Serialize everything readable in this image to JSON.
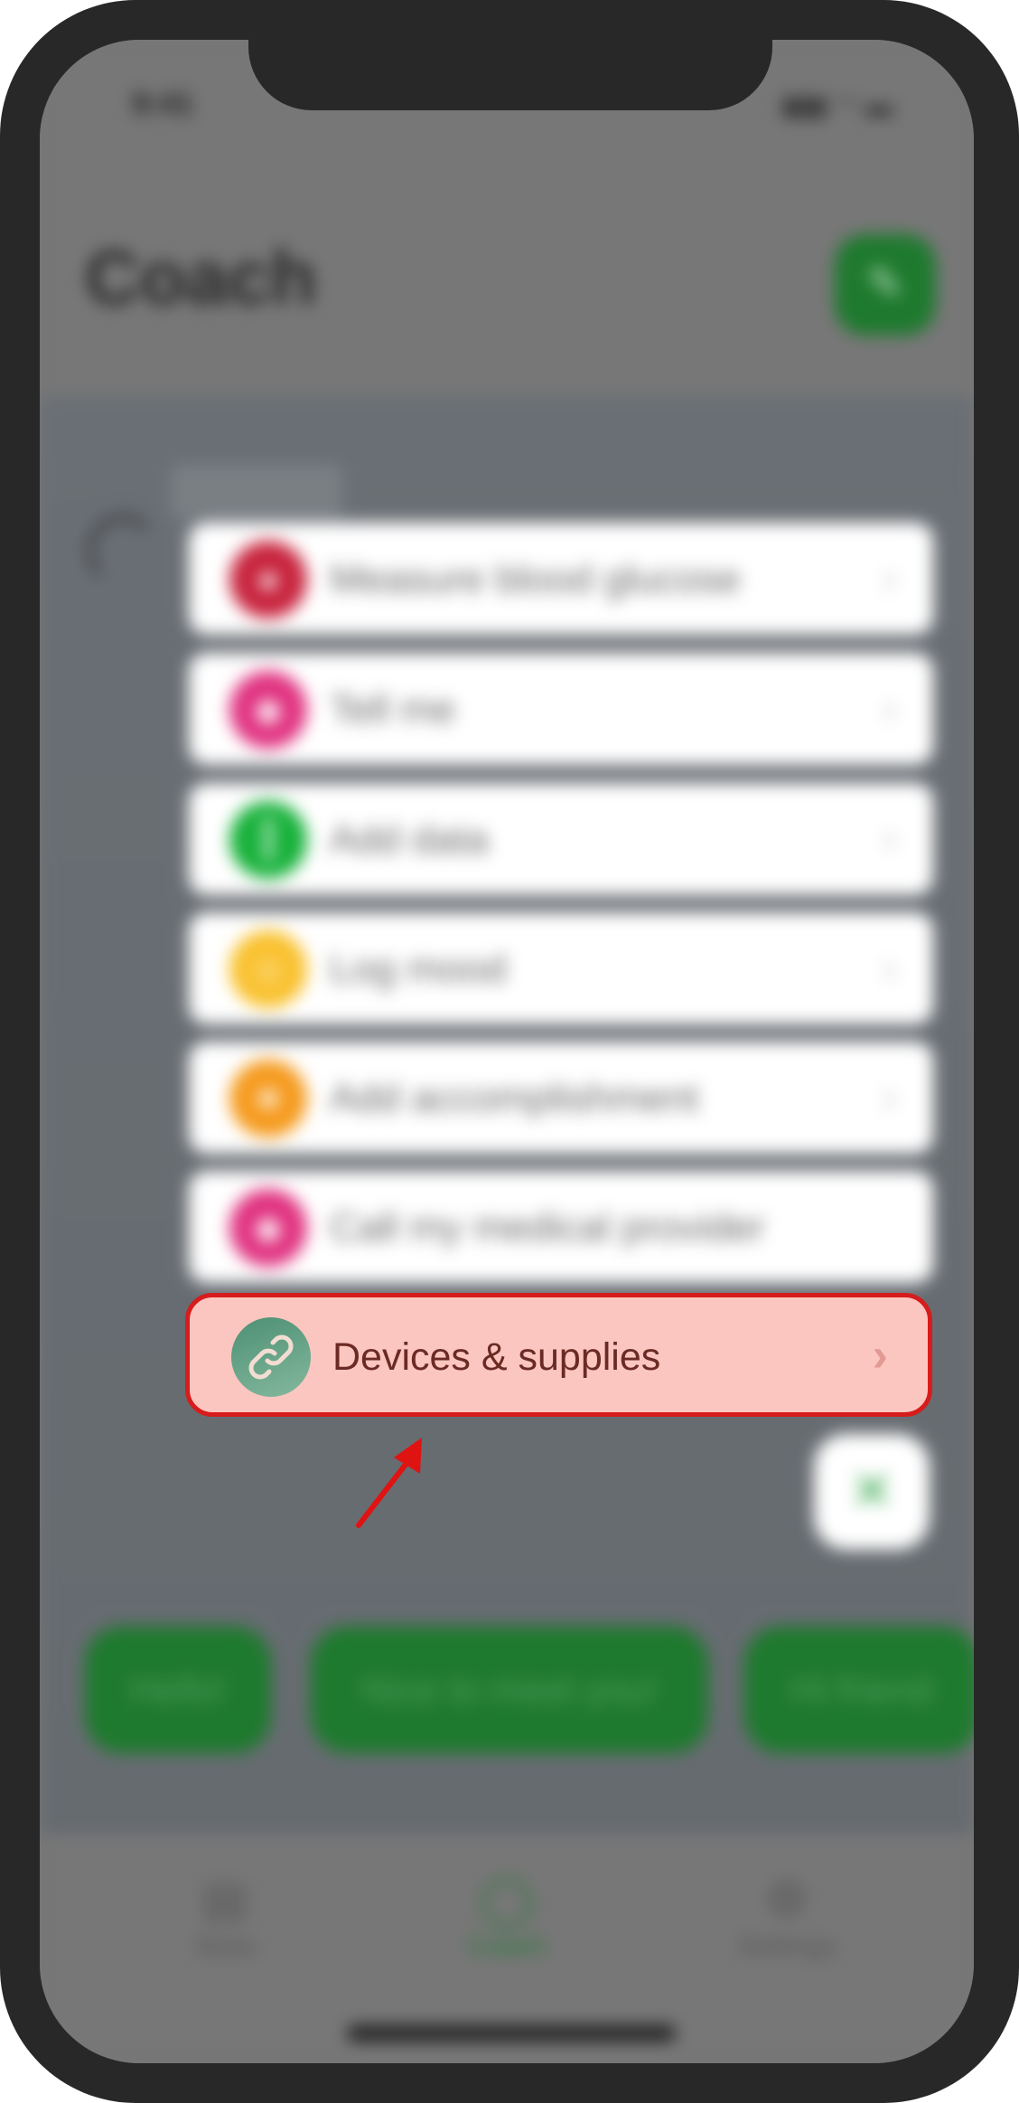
{
  "status_bar": {
    "time": "9:41",
    "icons": "▮▮▮ ◠ ▬"
  },
  "header": {
    "title": "Coach",
    "compose_icon": "edit-icon"
  },
  "menu": {
    "items": [
      {
        "label": "Measure blood glucose",
        "icon": "drop-icon",
        "color": "#c8243e",
        "glyph": "●"
      },
      {
        "label": "Tell me",
        "icon": "chat-icon",
        "color": "#e0317f",
        "glyph": "◆"
      },
      {
        "label": "Add data",
        "icon": "plus-icon",
        "color": "#17b13a",
        "glyph": "┃"
      },
      {
        "label": "Log mood",
        "icon": "smile-icon",
        "color": "#f9c12e",
        "glyph": "☺"
      },
      {
        "label": "Add accomplishment",
        "icon": "star-icon",
        "color": "#f59a1d",
        "glyph": "★"
      },
      {
        "label": "Call my medical provider",
        "icon": "phone-icon",
        "color": "#e0317f",
        "glyph": "◆"
      }
    ],
    "highlighted": {
      "label": "Devices & supplies",
      "icon": "link-icon",
      "chevron": "›"
    },
    "close_glyph": "✕"
  },
  "chips": [
    "Hello!",
    "Nice to meet you!",
    "Hi friend"
  ],
  "tabs": [
    {
      "label": "Stats",
      "icon": "chart-icon",
      "glyph": "▤",
      "active": false
    },
    {
      "label": "Coach",
      "icon": "chat-bubble-icon",
      "glyph": "◯",
      "active": true
    },
    {
      "label": "Settings",
      "icon": "gear-icon",
      "glyph": "⚙",
      "active": false
    }
  ],
  "accent_colors": {
    "highlight_border": "#d61c1c",
    "highlight_fill": "#fcc6c0",
    "brand_green": "#1e7a2e"
  }
}
